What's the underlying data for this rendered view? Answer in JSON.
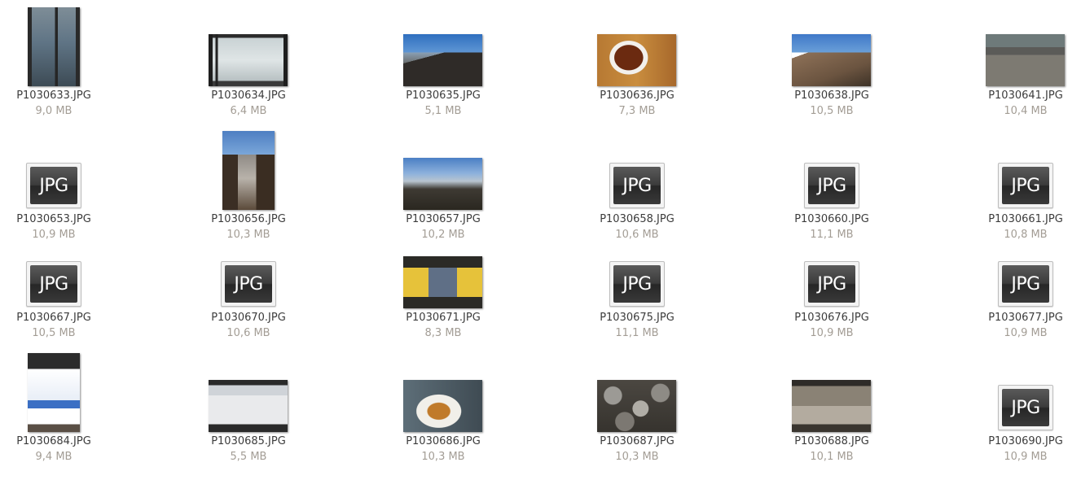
{
  "files": [
    {
      "name": "P1030633.JPG",
      "size": "9,0 MB",
      "thumb": "photo",
      "icon": "window-photo"
    },
    {
      "name": "P1030634.JPG",
      "size": "6,4 MB",
      "thumb": "photo",
      "icon": "frosted-window-photo"
    },
    {
      "name": "P1030635.JPG",
      "size": "5,1 MB",
      "thumb": "photo",
      "icon": "mountain-panorama-photo"
    },
    {
      "name": "P1030636.JPG",
      "size": "7,3 MB",
      "thumb": "photo",
      "icon": "tea-cup-photo"
    },
    {
      "name": "P1030638.JPG",
      "size": "10,5 MB",
      "thumb": "photo",
      "icon": "mountain-photo"
    },
    {
      "name": "P1030641.JPG",
      "size": "10,4 MB",
      "thumb": "photo",
      "icon": "courtyard-photo"
    },
    {
      "name": "P1030653.JPG",
      "size": "10,9 MB",
      "thumb": "generic",
      "icon": "jpg-file-icon"
    },
    {
      "name": "P1030656.JPG",
      "size": "10,3 MB",
      "thumb": "photo",
      "icon": "valley-photo"
    },
    {
      "name": "P1030657.JPG",
      "size": "10,2 MB",
      "thumb": "photo",
      "icon": "mountain-range-photo"
    },
    {
      "name": "P1030658.JPG",
      "size": "10,6 MB",
      "thumb": "generic",
      "icon": "jpg-file-icon"
    },
    {
      "name": "P1030660.JPG",
      "size": "11,1 MB",
      "thumb": "generic",
      "icon": "jpg-file-icon"
    },
    {
      "name": "P1030661.JPG",
      "size": "10,8 MB",
      "thumb": "generic",
      "icon": "jpg-file-icon"
    },
    {
      "name": "P1030667.JPG",
      "size": "10,5 MB",
      "thumb": "generic",
      "icon": "jpg-file-icon"
    },
    {
      "name": "P1030670.JPG",
      "size": "10,6 MB",
      "thumb": "generic",
      "icon": "jpg-file-icon"
    },
    {
      "name": "P1030671.JPG",
      "size": "8,3 MB",
      "thumb": "photo",
      "icon": "signboard-photo"
    },
    {
      "name": "P1030675.JPG",
      "size": "11,1 MB",
      "thumb": "generic",
      "icon": "jpg-file-icon"
    },
    {
      "name": "P1030676.JPG",
      "size": "10,9 MB",
      "thumb": "generic",
      "icon": "jpg-file-icon"
    },
    {
      "name": "P1030677.JPG",
      "size": "10,9 MB",
      "thumb": "generic",
      "icon": "jpg-file-icon"
    },
    {
      "name": "P1030684.JPG",
      "size": "9,4 MB",
      "thumb": "photo",
      "icon": "friendship-sign-photo"
    },
    {
      "name": "P1030685.JPG",
      "size": "5,5 MB",
      "thumb": "photo",
      "icon": "welcome-banner-photo"
    },
    {
      "name": "P1030686.JPG",
      "size": "10,3 MB",
      "thumb": "photo",
      "icon": "food-plate-photo"
    },
    {
      "name": "P1030687.JPG",
      "size": "10,3 MB",
      "thumb": "photo",
      "icon": "rocks-photo"
    },
    {
      "name": "P1030688.JPG",
      "size": "10,1 MB",
      "thumb": "photo",
      "icon": "sundial-photo"
    },
    {
      "name": "P1030690.JPG",
      "size": "10,9 MB",
      "thumb": "generic",
      "icon": "jpg-file-icon"
    }
  ],
  "generic_icon_text": "JPG",
  "colors": {
    "name_text": "#3c3c3c",
    "size_text": "#a39d95",
    "background": "#ffffff"
  }
}
